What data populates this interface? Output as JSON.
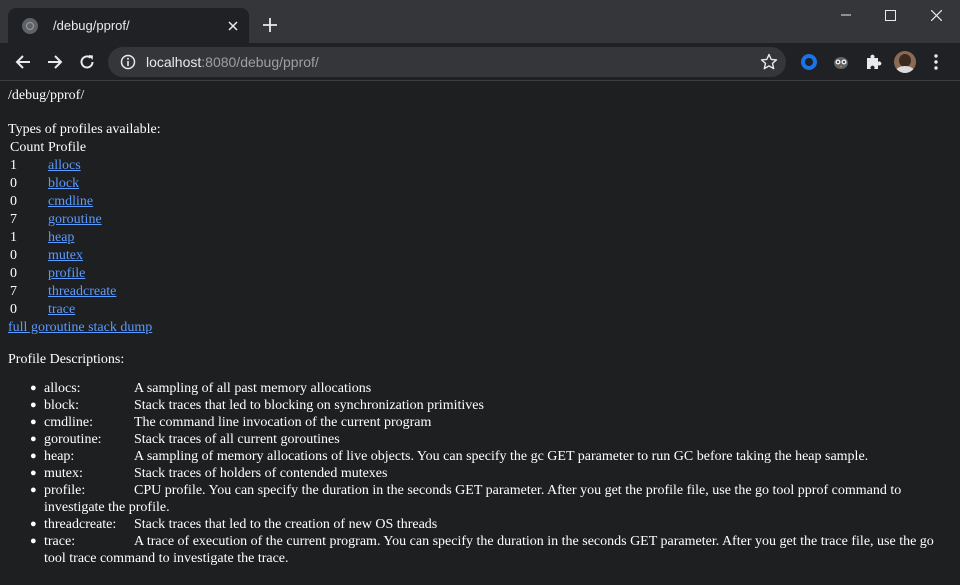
{
  "tab": {
    "title": "/debug/pprof/",
    "close_icon": "close-icon"
  },
  "window_controls": {
    "minimize": "minimize-icon",
    "maximize": "maximize-icon",
    "close": "close-icon"
  },
  "toolbar": {
    "url_host": "localhost",
    "url_rest": ":8080/debug/pprof/"
  },
  "page": {
    "heading": "/debug/pprof/",
    "types_title": "Types of profiles available:",
    "col_count": "Count",
    "col_profile": "Profile",
    "profiles": [
      {
        "count": "1",
        "name": "allocs"
      },
      {
        "count": "0",
        "name": "block"
      },
      {
        "count": "0",
        "name": "cmdline"
      },
      {
        "count": "7",
        "name": "goroutine"
      },
      {
        "count": "1",
        "name": "heap"
      },
      {
        "count": "0",
        "name": "mutex"
      },
      {
        "count": "0",
        "name": "profile"
      },
      {
        "count": "7",
        "name": "threadcreate"
      },
      {
        "count": "0",
        "name": "trace"
      }
    ],
    "full_dump_link": "full goroutine stack dump",
    "descriptions_title": "Profile Descriptions:",
    "descriptions": [
      {
        "name": "allocs:",
        "text": "A sampling of all past memory allocations"
      },
      {
        "name": "block:",
        "text": "Stack traces that led to blocking on synchronization primitives"
      },
      {
        "name": "cmdline:",
        "text": "The command line invocation of the current program"
      },
      {
        "name": "goroutine:",
        "text": "Stack traces of all current goroutines"
      },
      {
        "name": "heap:",
        "text": "A sampling of memory allocations of live objects. You can specify the gc GET parameter to run GC before taking the heap sample."
      },
      {
        "name": "mutex:",
        "text": "Stack traces of holders of contended mutexes"
      },
      {
        "name": "profile:",
        "text": "CPU profile. You can specify the duration in the seconds GET parameter. After you get the profile file, use the go tool pprof command to investigate the profile."
      },
      {
        "name": "threadcreate:",
        "text": "Stack traces that led to the creation of new OS threads"
      },
      {
        "name": "trace:",
        "text": "A trace of execution of the current program. You can specify the duration in the seconds GET parameter. After you get the trace file, use the go tool trace command to investigate the trace."
      }
    ]
  }
}
